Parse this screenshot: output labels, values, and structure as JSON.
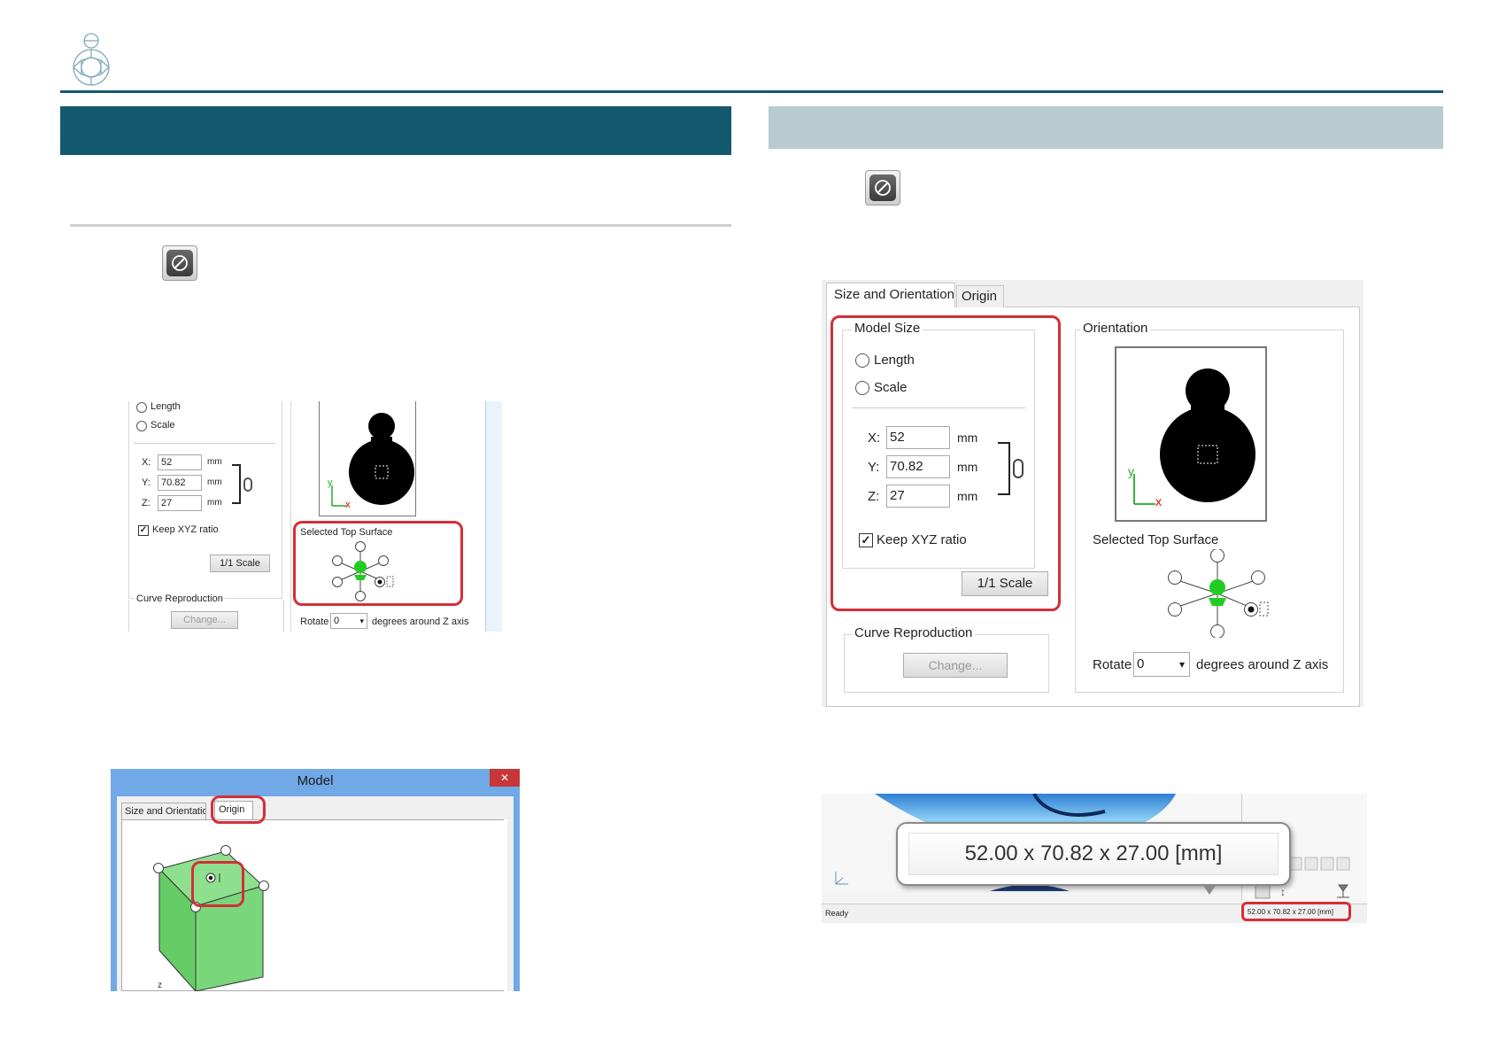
{
  "page": {
    "accent": "#14596e",
    "header_right_color": "#b8cbd0",
    "highlight": "#d32f3a"
  },
  "left": {
    "dialog1": {
      "length_label": "Length",
      "scale_label": "Scale",
      "x_label": "X:",
      "y_label": "Y:",
      "z_label": "Z:",
      "x_value": "52",
      "y_value": "70.82",
      "z_value": "27",
      "unit": "mm",
      "keep_ratio_label": "Keep XYZ ratio",
      "scale_button": "1/1 Scale",
      "curve_label": "Curve Reproduction",
      "change_button": "Change...",
      "selected_top_label": "Selected Top Surface",
      "rotate_label": "Rotate",
      "rotate_value": "0",
      "rotate_suffix": "degrees around Z axis"
    },
    "dialog2": {
      "title": "Model",
      "close_glyph": "✕",
      "tab1": "Size and Orientation",
      "tab2": "Origin"
    }
  },
  "right": {
    "dialog": {
      "tab1": "Size and Orientation",
      "tab2": "Origin",
      "model_size_label": "Model Size",
      "length_label": "Length",
      "scale_label": "Scale",
      "x_label": "X:",
      "y_label": "Y:",
      "z_label": "Z:",
      "x_value": "52",
      "y_value": "70.82",
      "z_value": "27",
      "unit": "mm",
      "keep_ratio_label": "Keep XYZ ratio",
      "scale_button": "1/1 Scale",
      "orientation_label": "Orientation",
      "selected_top_label": "Selected Top Surface",
      "curve_label": "Curve Reproduction",
      "change_button": "Change...",
      "rotate_label": "Rotate",
      "rotate_value": "0",
      "rotate_suffix": "degrees around Z axis"
    },
    "status": {
      "tooltip": "52.00 x 70.82 x 27.00 [mm]",
      "ready": "Ready",
      "small_readout": "52.00 x 70.82 x 27.00 [mm]"
    }
  }
}
